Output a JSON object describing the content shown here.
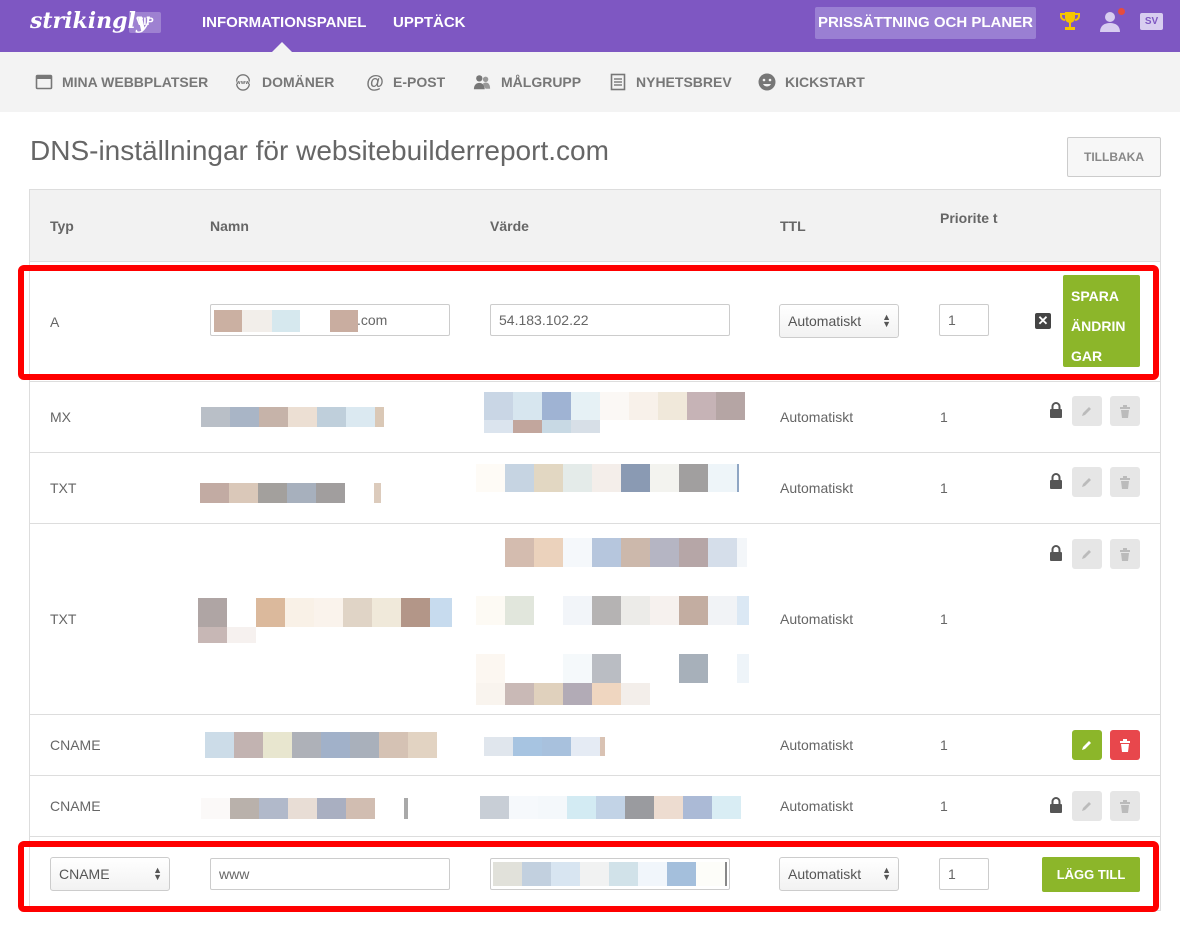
{
  "topbar": {
    "logo": "strikingly",
    "vip_badge": "VIP",
    "nav": [
      "INFORMATIONSPANEL",
      "UPPTÄCK"
    ],
    "pricing_button": "PRISSÄTTNING OCH PLANER",
    "language": "SV",
    "icons": [
      "trophy-icon",
      "user-icon"
    ],
    "brand_color": "#7e57c2"
  },
  "subnav": [
    {
      "label": "MINA WEBBPLATSER",
      "icon": "browser-window-icon"
    },
    {
      "label": "DOMÄNER",
      "icon": "www-icon"
    },
    {
      "label": "E-POST",
      "icon": "at-icon"
    },
    {
      "label": "MÅLGRUPP",
      "icon": "users-icon"
    },
    {
      "label": "NYHETSBREV",
      "icon": "newsletter-icon"
    },
    {
      "label": "KICKSTART",
      "icon": "smiley-icon"
    }
  ],
  "page": {
    "title": "DNS-inställningar för websitebuilderreport.com",
    "back_button": "TILLBAKA"
  },
  "table": {
    "headers": [
      "Typ",
      "Namn",
      "Värde",
      "TTL",
      "Priorite t"
    ],
    "edit_row": {
      "type": "A",
      "name_suffix": ".com",
      "value": "54.183.102.22",
      "ttl": "Automatiskt",
      "priority": "1",
      "save_button": "SPARA ÄNDRIN GAR"
    },
    "rows": [
      {
        "type": "MX",
        "ttl": "Automatiskt",
        "priority": "1",
        "locked": true
      },
      {
        "type": "TXT",
        "ttl": "Automatiskt",
        "priority": "1",
        "locked": true
      },
      {
        "type": "TXT",
        "ttl": "Automatiskt",
        "priority": "1",
        "locked": true
      },
      {
        "type": "CNAME",
        "ttl": "Automatiskt",
        "priority": "1",
        "locked": false
      },
      {
        "type": "CNAME",
        "ttl": "Automatiskt",
        "priority": "1",
        "locked": true
      }
    ],
    "add_row": {
      "type": "CNAME",
      "name": "www",
      "ttl": "Automatiskt",
      "priority": "1",
      "add_button": "LÄGG TILL"
    }
  },
  "colors": {
    "accent_green": "#8cb62a",
    "delete_red": "#e8474c",
    "highlight_red": "#ff0000"
  }
}
